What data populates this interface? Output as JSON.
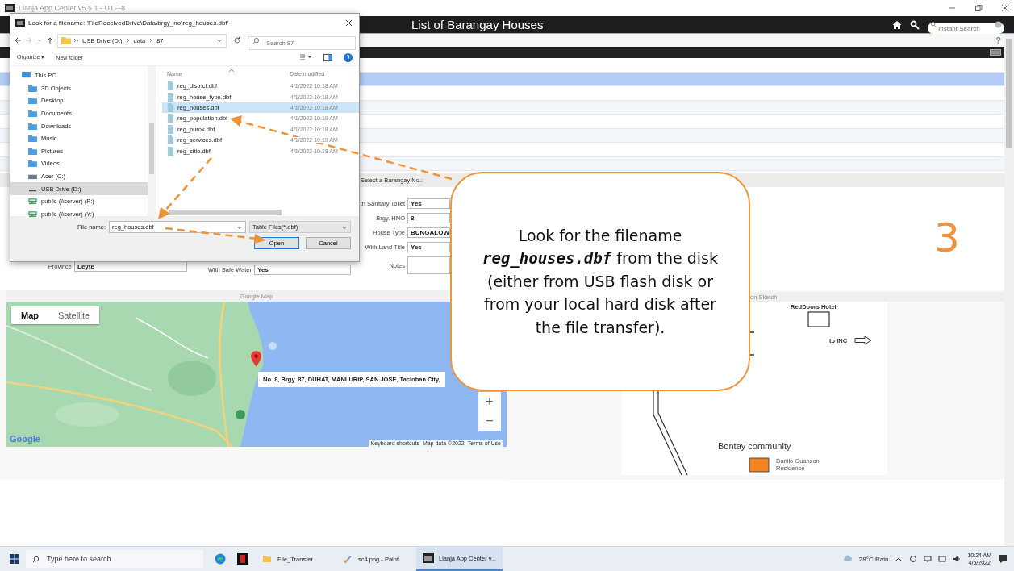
{
  "window": {
    "title": "Lianja App Center v5.5.1 - UTF-8"
  },
  "app_header": {
    "title": "List of Barangay Houses",
    "search_placeholder": "Instant Search"
  },
  "help": "?",
  "grid_rows": [
    {
      "selected": false
    },
    {
      "selected": true
    },
    {
      "selected": false
    },
    {
      "selected": false
    },
    {
      "selected": false
    },
    {
      "selected": false
    },
    {
      "selected": false
    },
    {
      "selected": false
    }
  ],
  "form": {
    "section_title": "Select a Barangay No.:",
    "province": {
      "label": "Province",
      "value": "Leyte"
    },
    "safe_water": {
      "label": "With Safe Water",
      "value": "Yes"
    },
    "fields": [
      {
        "kind": "text",
        "label": "th Sanitary Toilet",
        "value": "Yes"
      },
      {
        "kind": "text",
        "label": "Brgy. HNO",
        "value": "8"
      },
      {
        "kind": "text",
        "label": "House Type",
        "value": "BUNGALOW"
      },
      {
        "kind": "text",
        "label": "With Land Title",
        "value": "Yes"
      },
      {
        "kind": "textarea",
        "label": "Notes"
      }
    ]
  },
  "map": {
    "title": "Google Map",
    "map_types": [
      {
        "label": "Map",
        "selected": true
      },
      {
        "label": "Satellite",
        "selected": false
      }
    ],
    "info": "No. 8, Brgy. 87, DUHAT, MANLURIP, SAN JOSE, Tacloban City,",
    "zoom": [
      "+",
      "−"
    ],
    "footer": [
      "Keyboard shortcuts",
      "Map data ©2022",
      "Terms of Use"
    ],
    "logo": "Google"
  },
  "sketch": {
    "title": "on Sketch",
    "hotel": "RedDoors Hotel",
    "direction": "to INC",
    "community": "Bontay community",
    "residence": [
      "Danilo Guanzon",
      "Residence"
    ]
  },
  "step": "3",
  "dialog": {
    "title": "Look for a filename: 'FileReceivedDrive\\Data\\brgy_no\\reg_houses.dbf'",
    "path": [
      "USB Drive (D:)",
      "data",
      "87"
    ],
    "search_placeholder": "Search 87",
    "toolbar": [
      "Organize ▾",
      "New folder"
    ],
    "nav": [
      {
        "label": "This PC",
        "kind": "pc",
        "selected": false
      },
      {
        "label": "3D Objects",
        "kind": "folder",
        "selected": false
      },
      {
        "label": "Desktop",
        "kind": "folder",
        "selected": false
      },
      {
        "label": "Documents",
        "kind": "folder",
        "selected": false
      },
      {
        "label": "Downloads",
        "kind": "folder",
        "selected": false
      },
      {
        "label": "Music",
        "kind": "folder",
        "selected": false
      },
      {
        "label": "Pictures",
        "kind": "folder",
        "selected": false
      },
      {
        "label": "Videos",
        "kind": "folder",
        "selected": false
      },
      {
        "label": "Acer (C:)",
        "kind": "drive",
        "selected": false
      },
      {
        "label": "USB Drive (D:)",
        "kind": "usb",
        "selected": true
      },
      {
        "label": "public (\\\\server) (P:)",
        "kind": "network",
        "selected": false
      },
      {
        "label": "public (\\\\server) (Y:)",
        "kind": "network",
        "selected": false
      }
    ],
    "columns": [
      "Name",
      "Date modified"
    ],
    "files": [
      {
        "name": "reg_district.dbf",
        "date": "4/1/2022 10:18 AM",
        "selected": false
      },
      {
        "name": "reg_house_type.dbf",
        "date": "4/1/2022 10:18 AM",
        "selected": false
      },
      {
        "name": "reg_houses.dbf",
        "date": "4/1/2022 10:18 AM",
        "selected": true
      },
      {
        "name": "reg_population.dbf",
        "date": "4/1/2022 10:19 AM",
        "selected": false
      },
      {
        "name": "reg_purok.dbf",
        "date": "4/1/2022 10:18 AM",
        "selected": false
      },
      {
        "name": "reg_services.dbf",
        "date": "4/1/2022 10:19 AM",
        "selected": false
      },
      {
        "name": "reg_sitio.dbf",
        "date": "4/1/2022 10:18 AM",
        "selected": false
      }
    ],
    "filename_label": "File name:",
    "filename": "reg_houses.dbf",
    "filter": "Table Files(*.dbf)",
    "buttons": [
      "Open",
      "Cancel"
    ]
  },
  "callout": "Look for the filename **reg_houses.dbf** from the disk (either from USB flash disk or from your local hard disk after the file transfer).",
  "taskbar": {
    "search_placeholder": "Type here to search",
    "apps": [
      {
        "label": "File_Transfer",
        "kind": "folder",
        "selected": false
      },
      {
        "label": "sc4.png - Paint",
        "kind": "paint",
        "selected": false
      },
      {
        "label": "Lianja App Center v...",
        "kind": "app",
        "selected": true
      }
    ],
    "weather": "28°C Rain",
    "time": "10:24 AM",
    "date": "4/5/2022"
  }
}
